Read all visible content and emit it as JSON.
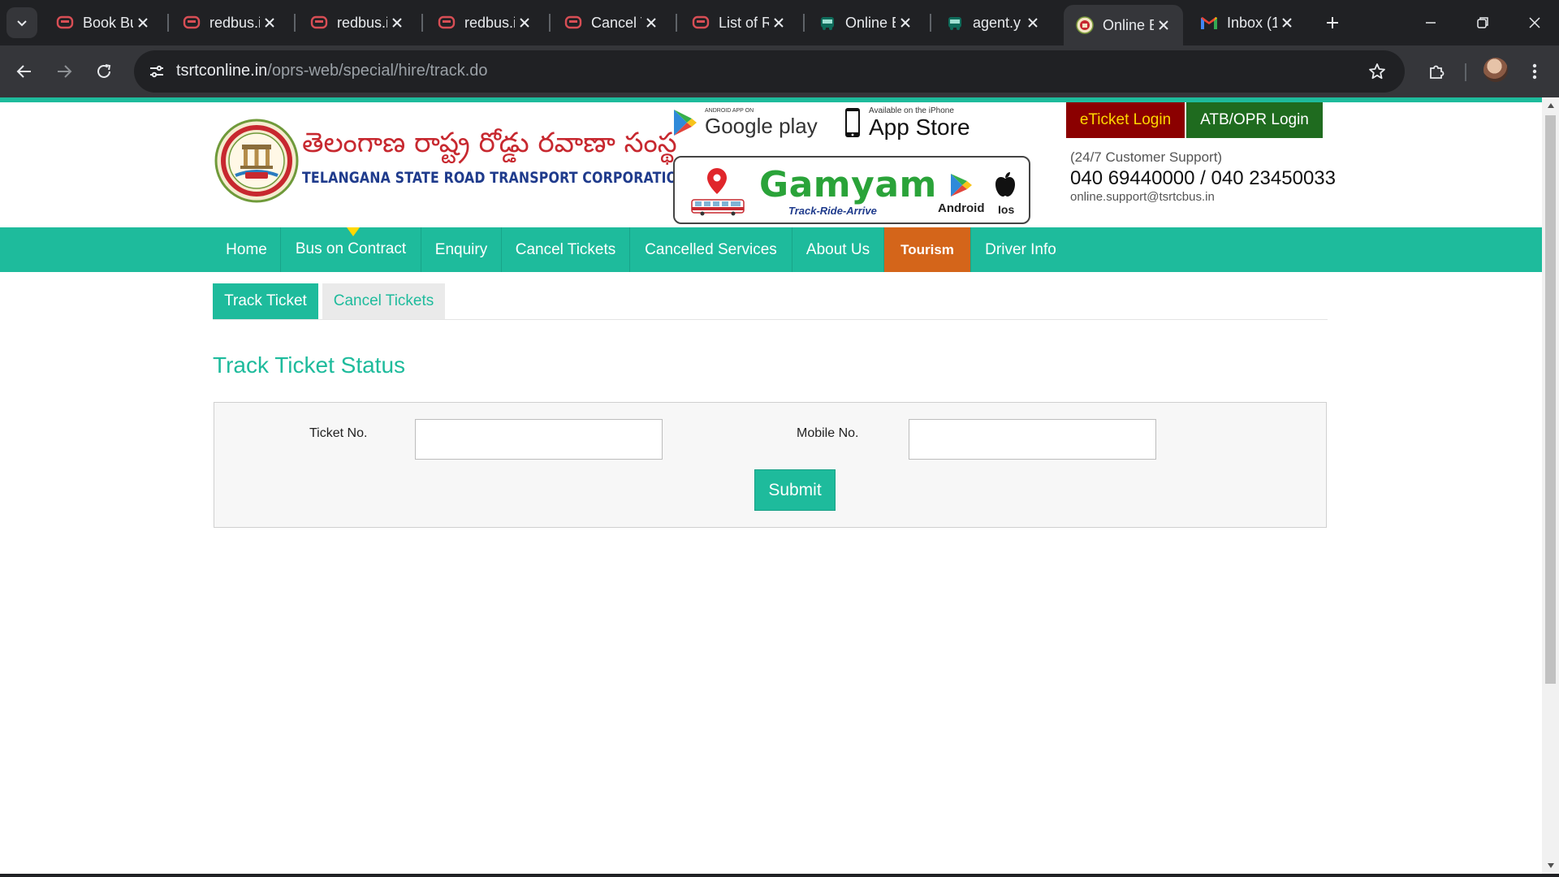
{
  "browser": {
    "tabs": [
      {
        "title": "Book Bu",
        "favicon": "redbus-icon",
        "active": false
      },
      {
        "title": "redbus.i",
        "favicon": "redbus-icon",
        "active": false
      },
      {
        "title": "redbus.i",
        "favicon": "redbus-icon",
        "active": false
      },
      {
        "title": "redbus.i",
        "favicon": "redbus-icon",
        "active": false
      },
      {
        "title": "Cancel T",
        "favicon": "redbus-icon",
        "active": false
      },
      {
        "title": "List of R",
        "favicon": "redbus-icon",
        "active": false
      },
      {
        "title": "Online E",
        "favicon": "bus-icon",
        "active": false
      },
      {
        "title": "agent.y",
        "favicon": "bus-icon",
        "active": false
      },
      {
        "title": "Online E",
        "favicon": "tsrtc-icon",
        "active": true
      },
      {
        "title": "Inbox (1",
        "favicon": "gmail-icon",
        "active": false
      }
    ],
    "url_host": "tsrtconline.in",
    "url_path": "/oprs-web/special/hire/track.do"
  },
  "header": {
    "brand_telugu": "తెలంగాణ రాష్ట్ర రోడ్డు రవాణా సంస్థ",
    "brand_english": "TELANGANA STATE ROAD TRANSPORT CORPORATION",
    "google_play_small": "ANDROID APP ON",
    "google_play_big": "Google play",
    "app_store_small": "Available on the iPhone",
    "app_store_big": "App Store",
    "gamyam": {
      "name": "Gamyam",
      "tagline": "Track-Ride-Arrive",
      "android_label": "Android",
      "ios_label": "Ios"
    },
    "eticket_login": "eTicket Login",
    "atb_login": "ATB/OPR Login",
    "support_title": "(24/7 Customer Support)",
    "support_phones": "040 69440000 / 040 23450033",
    "support_email": "online.support@tsrtcbus.in"
  },
  "nav": {
    "items": [
      "Home",
      "Bus on Contract",
      "Enquiry",
      "Cancel Tickets",
      "Cancelled Services",
      "About Us",
      "Tourism",
      "Driver Info"
    ]
  },
  "subtabs": {
    "active": "Track Ticket",
    "inactive": "Cancel Tickets"
  },
  "page": {
    "title": "Track Ticket Status"
  },
  "form": {
    "ticket_label": "Ticket No.",
    "ticket_value": "",
    "mobile_label": "Mobile No.",
    "mobile_value": "",
    "submit_label": "Submit"
  },
  "colors": {
    "brand_teal": "#1ebb9c",
    "tourism_orange": "#d4651a",
    "eticket_red": "#8b0000",
    "atb_green": "#1f6b1f"
  }
}
